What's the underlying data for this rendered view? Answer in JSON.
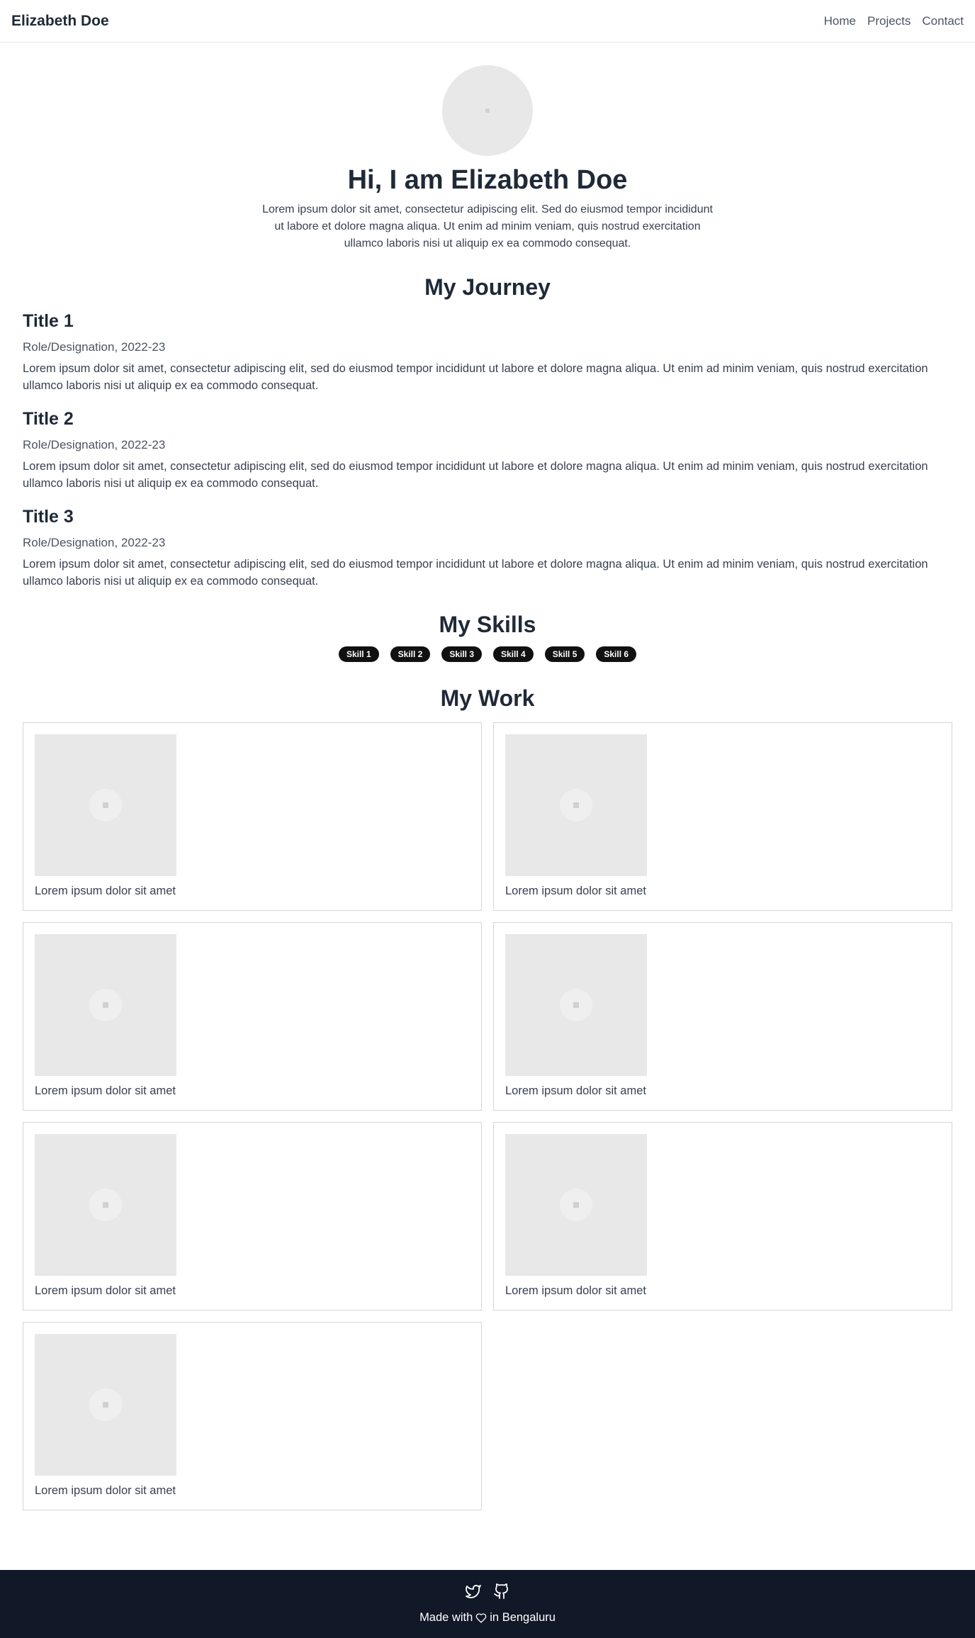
{
  "nav": {
    "brand": "Elizabeth Doe",
    "links": [
      "Home",
      "Projects",
      "Contact"
    ]
  },
  "hero": {
    "title": "Hi, I am Elizabeth Doe",
    "intro": "Lorem ipsum dolor sit amet, consectetur adipiscing elit. Sed do eiusmod tempor incididunt ut labore et dolore magna aliqua. Ut enim ad minim veniam, quis nostrud exercitation ullamco laboris nisi ut aliquip ex ea commodo consequat."
  },
  "journey": {
    "heading": "My Journey",
    "entries": [
      {
        "title": "Title 1",
        "role": "Role/Designation, 2022-23",
        "text": "Lorem ipsum dolor sit amet, consectetur adipiscing elit, sed do eiusmod tempor incididunt ut labore et dolore magna aliqua. Ut enim ad minim veniam, quis nostrud exercitation ullamco laboris nisi ut aliquip ex ea commodo consequat."
      },
      {
        "title": "Title 2",
        "role": "Role/Designation, 2022-23",
        "text": "Lorem ipsum dolor sit amet, consectetur adipiscing elit, sed do eiusmod tempor incididunt ut labore et dolore magna aliqua. Ut enim ad minim veniam, quis nostrud exercitation ullamco laboris nisi ut aliquip ex ea commodo consequat."
      },
      {
        "title": "Title 3",
        "role": "Role/Designation, 2022-23",
        "text": "Lorem ipsum dolor sit amet, consectetur adipiscing elit, sed do eiusmod tempor incididunt ut labore et dolore magna aliqua. Ut enim ad minim veniam, quis nostrud exercitation ullamco laboris nisi ut aliquip ex ea commodo consequat."
      }
    ]
  },
  "skills": {
    "heading": "My Skills",
    "items": [
      "Skill 1",
      "Skill 2",
      "Skill 3",
      "Skill 4",
      "Skill 5",
      "Skill 6"
    ]
  },
  "work": {
    "heading": "My Work",
    "cards": [
      {
        "caption": "Lorem ipsum dolor sit amet"
      },
      {
        "caption": "Lorem ipsum dolor sit amet"
      },
      {
        "caption": "Lorem ipsum dolor sit amet"
      },
      {
        "caption": "Lorem ipsum dolor sit amet"
      },
      {
        "caption": "Lorem ipsum dolor sit amet"
      },
      {
        "caption": "Lorem ipsum dolor sit amet"
      },
      {
        "caption": "Lorem ipsum dolor sit amet"
      }
    ]
  },
  "footer": {
    "icons": [
      "twitter-icon",
      "github-icon"
    ],
    "made_prefix": "Made with",
    "made_suffix": "in Bengaluru"
  },
  "colors": {
    "footer_bg": "#111827",
    "skill_bg": "#111111",
    "text": "#1f2937"
  }
}
